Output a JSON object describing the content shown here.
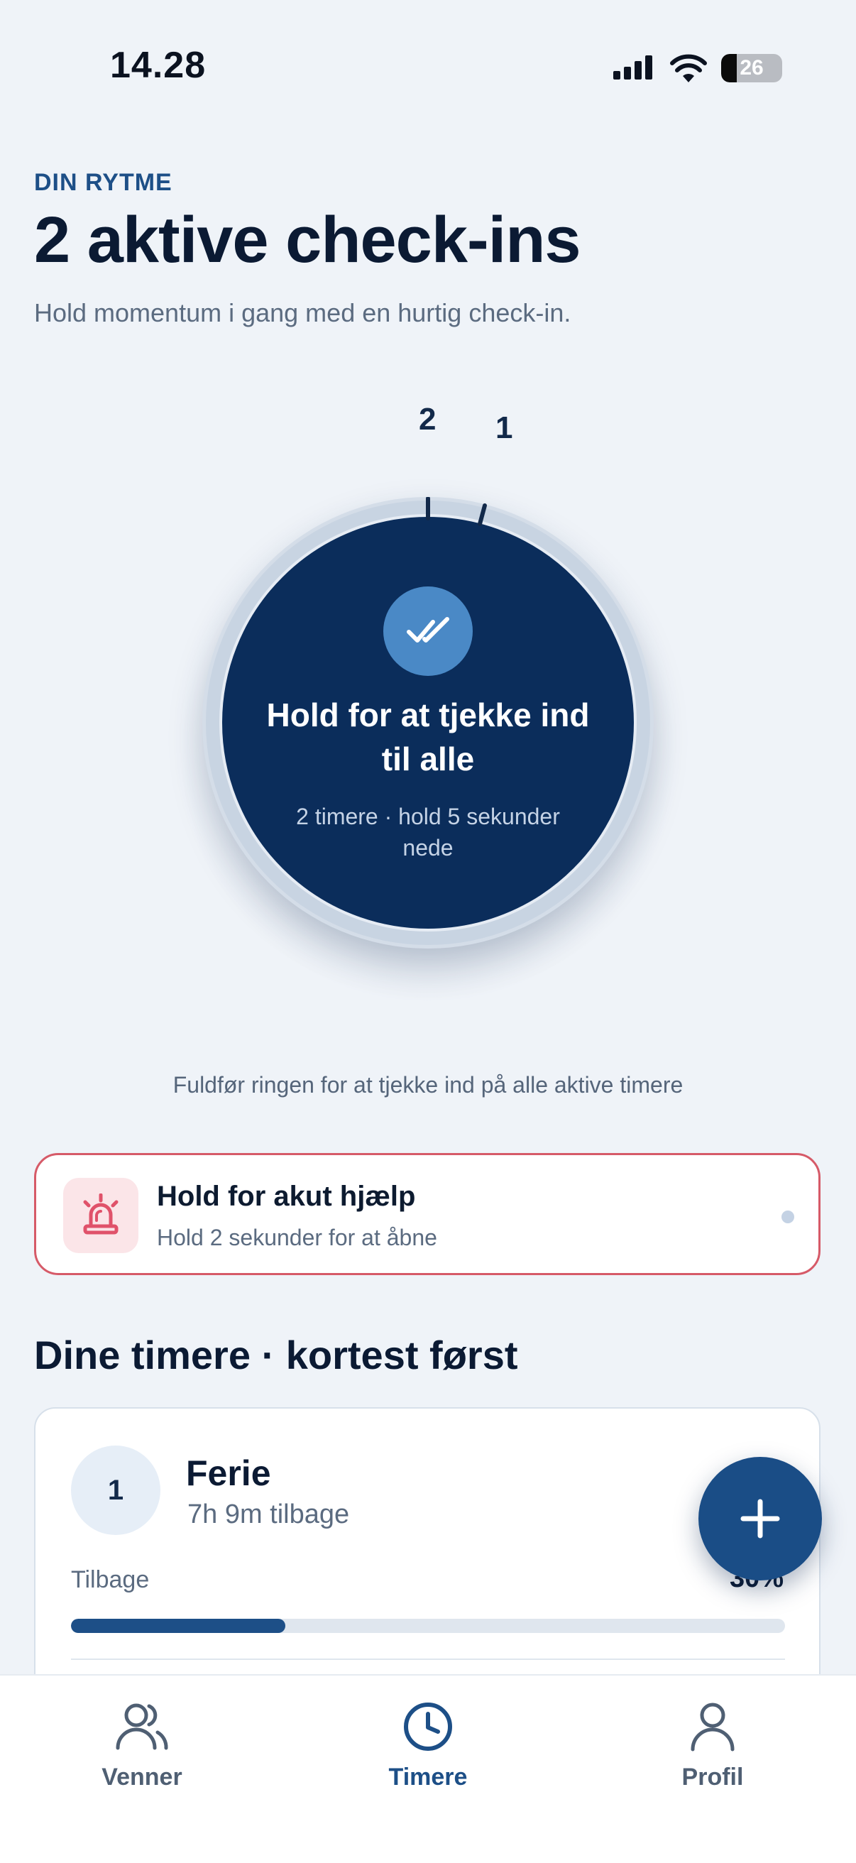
{
  "status_bar": {
    "time": "14.28",
    "battery": "26"
  },
  "header": {
    "eyebrow": "DIN RYTME",
    "title": "2 aktive check-ins",
    "subtitle": "Hold momentum i gang med en hurtig check-in."
  },
  "dial": {
    "tick_labels": [
      "2",
      "1"
    ],
    "title": "Hold for at tjekke ind til alle",
    "subtitle": "2 timere · hold 5 sekunder nede",
    "hint": "Fuldfør ringen for at tjekke ind på alle aktive timere"
  },
  "emergency": {
    "title": "Hold for akut hjælp",
    "subtitle": "Hold 2 sekunder for at åbne",
    "icon": "siren-icon"
  },
  "timers": {
    "heading": "Dine timere · kortest først",
    "items": [
      {
        "rank": "1",
        "name": "Ferie",
        "remaining": "7h 9m tilbage",
        "progress_label": "Tilbage",
        "progress_text": "30%",
        "progress_value": 0.3
      }
    ]
  },
  "fab": {
    "icon": "plus-icon"
  },
  "tab_bar": {
    "tabs": [
      {
        "label": "Venner",
        "icon": "friends-icon",
        "active": false
      },
      {
        "label": "Timere",
        "icon": "clock-icon",
        "active": true
      },
      {
        "label": "Profil",
        "icon": "person-icon",
        "active": false
      }
    ]
  },
  "colors": {
    "accent": "#1d4f87",
    "dial": "#0b2d5b",
    "emergency": "#d65a68",
    "background": "#eff3f8"
  }
}
